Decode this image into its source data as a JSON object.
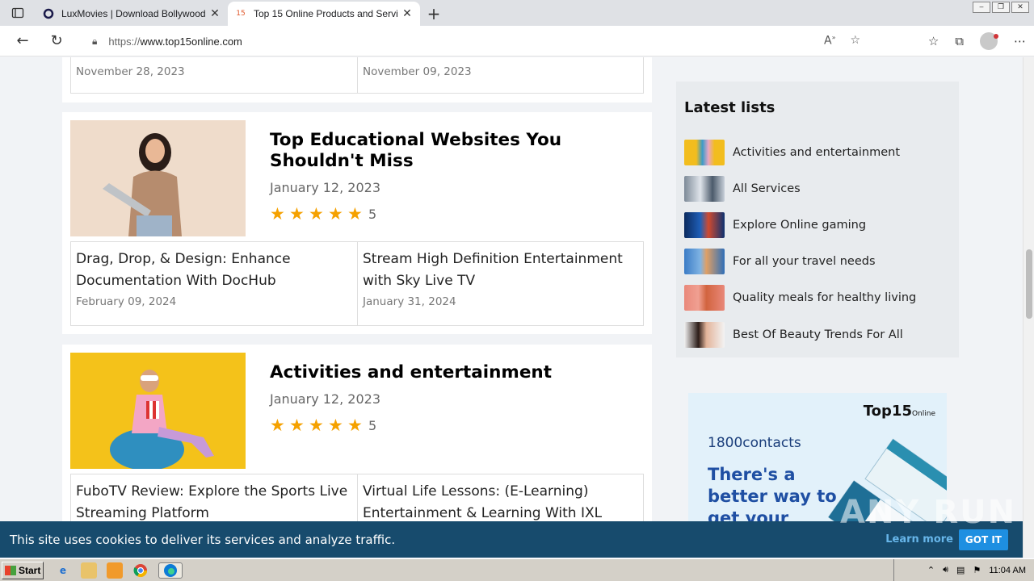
{
  "browser": {
    "tabs": [
      {
        "title": "LuxMovies | Download Bollywood",
        "favicon": "luxmovies-favicon"
      },
      {
        "title": "Top 15 Online Products and Servi",
        "favicon": "15"
      }
    ],
    "url_protocol": "https://",
    "url_host": "www.top15online.com",
    "window_controls": [
      "minimize",
      "restore",
      "close"
    ]
  },
  "page": {
    "top_partial": {
      "left_date": "November 28, 2023",
      "right_date": "November 09, 2023"
    },
    "cards": [
      {
        "title": "Top Educational Websites You Shouldn't Miss",
        "date": "January 12, 2023",
        "rating": "5",
        "stars": 5,
        "related": [
          {
            "title": "Drag, Drop, & Design: Enhance Documentation With DocHub",
            "date": "February 09, 2024"
          },
          {
            "title": "Stream High Definition Entertainment with Sky Live TV",
            "date": "January 31, 2024"
          }
        ]
      },
      {
        "title": "Activities and entertainment",
        "date": "January 12, 2023",
        "rating": "5",
        "stars": 5,
        "related": [
          {
            "title": "FuboTV Review: Explore the Sports Live Streaming Platform",
            "date": ""
          },
          {
            "title": "Virtual Life Lessons: (E-Learning) Entertainment & Learning With IXL",
            "date": ""
          }
        ]
      }
    ],
    "sidebar": {
      "heading": "Latest lists",
      "items": [
        {
          "label": "Activities and entertainment"
        },
        {
          "label": "All Services"
        },
        {
          "label": "Explore Online gaming"
        },
        {
          "label": "For all your travel needs"
        },
        {
          "label": "Quality meals for healthy living"
        },
        {
          "label": "Best Of Beauty Trends For All"
        }
      ]
    },
    "ad": {
      "brand": "Top15",
      "brand_suffix": "Online",
      "advertiser": "1800contacts",
      "message": "There's a better way to get your"
    },
    "cookie": {
      "message": "This site uses cookies to deliver its services and analyze traffic.",
      "learn_more": "Learn more",
      "accept": "GOT IT"
    },
    "watermark": "ANY RUN"
  },
  "taskbar": {
    "start": "Start",
    "clock": "11:04 AM"
  },
  "colors": {
    "star": "#f5a100",
    "cookie_bg": "#174b6d",
    "accept_btn": "#1e8fe1"
  }
}
